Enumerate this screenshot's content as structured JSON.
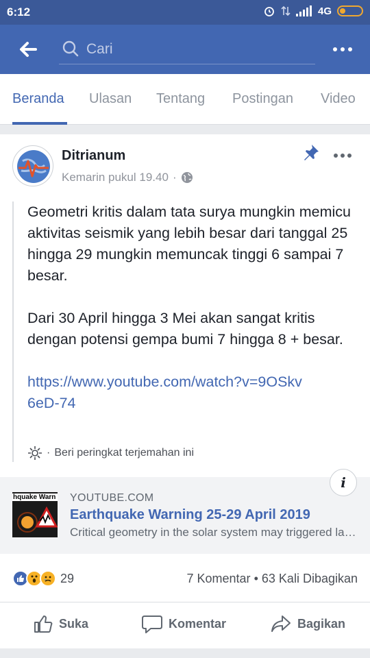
{
  "status_bar": {
    "time": "6:12",
    "network": "4G"
  },
  "search": {
    "placeholder": "Cari"
  },
  "tabs": [
    "Beranda",
    "Ulasan",
    "Tentang",
    "Postingan",
    "Video"
  ],
  "post": {
    "author": "Ditrianum",
    "timestamp": "Kemarin pukul 19.40",
    "separator": "·",
    "paragraphs": [
      "Geometri kritis dalam tata surya mungkin memicu aktivitas seismik yang lebih besar dari tanggal 25 hingga 29 mungkin memuncak tinggi 6 sampai 7 besar.",
      "Dari 30 April hingga 3 Mei akan sangat kritis dengan potensi gempa bumi 7 hingga 8 + besar."
    ],
    "link": "https://www.youtube.com/watch?v=9OSkv6eD-74",
    "rate_translation": "Beri peringkat terjemahan ini"
  },
  "link_card": {
    "thumb_text": "hquake Warn",
    "domain": "YOUTUBE.COM",
    "title": "Earthquake Warning 25-29 April 2019",
    "description": "Critical geometry in the solar system may triggered larger seismic activity",
    "info": "i"
  },
  "stats": {
    "reaction_count": "29",
    "comments": "7 Komentar",
    "shares": "63 Kali Dibagikan",
    "dot": "•"
  },
  "actions": {
    "like": "Suka",
    "comment": "Komentar",
    "share": "Bagikan"
  },
  "colors": {
    "brand": "#4267b2",
    "status": "#3b5998"
  }
}
